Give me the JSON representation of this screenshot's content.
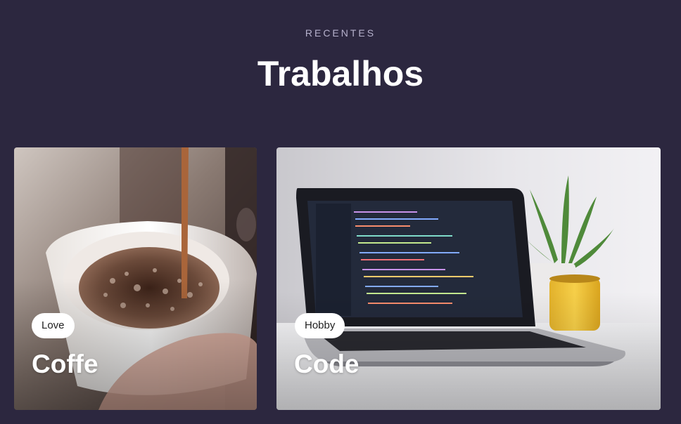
{
  "section": {
    "eyebrow": "RECENTES",
    "title": "Trabalhos"
  },
  "cards": [
    {
      "tag": "Love",
      "title": "Coffe",
      "image": "coffee-pour-photo"
    },
    {
      "tag": "Hobby",
      "title": "Code",
      "image": "laptop-code-photo"
    }
  ],
  "colors": {
    "background": "#2c273f",
    "eyebrow": "#b6b1cc",
    "tag_bg": "#ffffff"
  }
}
